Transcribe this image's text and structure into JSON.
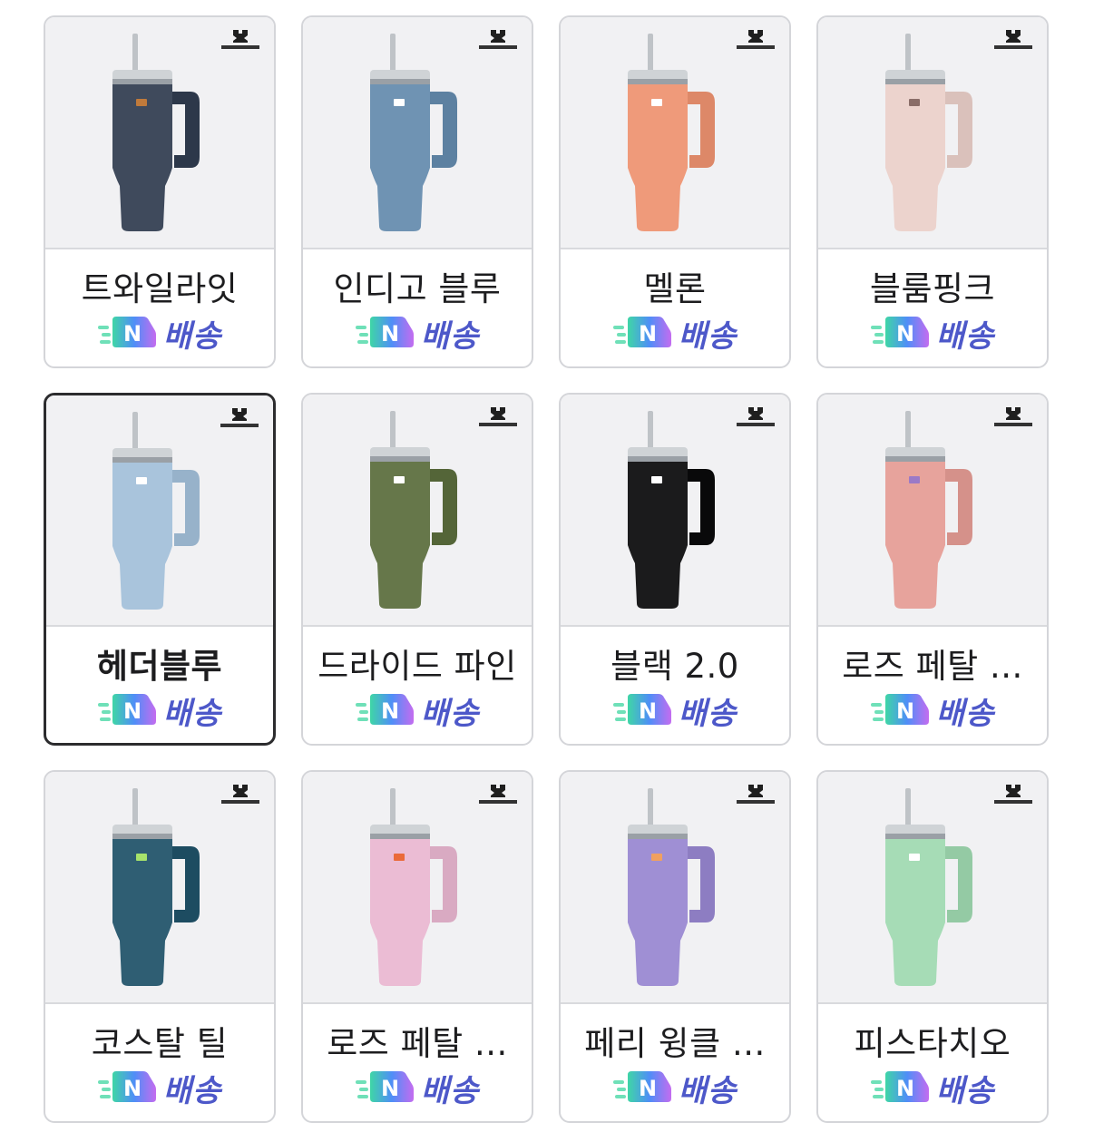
{
  "products": [
    {
      "name": "트와일라잇",
      "color": "#3f4a5c",
      "accent": "#c07a3b",
      "selected": false
    },
    {
      "name": "인디고 블루",
      "color": "#6f93b3",
      "accent": "#ffffff",
      "selected": false
    },
    {
      "name": "멜론",
      "color": "#ef9a7a",
      "accent": "#ffffff",
      "selected": false
    },
    {
      "name": "블룸핑크",
      "color": "#ecd3cd",
      "accent": "#8a6d68",
      "selected": false
    },
    {
      "name": "헤더블루",
      "color": "#a9c4dc",
      "accent": "#ffffff",
      "selected": true
    },
    {
      "name": "드라이드 파인",
      "color": "#66774a",
      "accent": "#ffffff",
      "selected": false
    },
    {
      "name": "블랙 2.0",
      "color": "#1b1b1c",
      "accent": "#ffffff",
      "selected": false
    },
    {
      "name": "로즈 페탈 ...",
      "color": "#e7a39c",
      "accent": "#9b7ac7",
      "selected": false
    },
    {
      "name": "코스탈 틸",
      "color": "#2f5e73",
      "accent": "#a7e36b",
      "selected": false
    },
    {
      "name": "로즈 페탈 ...",
      "color": "#ebbcd4",
      "accent": "#ea6a3a",
      "selected": false
    },
    {
      "name": "페리 윙클 ...",
      "color": "#9f8fd4",
      "accent": "#f0a060",
      "selected": false
    },
    {
      "name": "피스타치오",
      "color": "#a6dcb6",
      "accent": "#ffffff",
      "selected": false
    }
  ],
  "shipping": {
    "badge_letter": "N",
    "label": "배송",
    "label_color": "#4d58c9"
  },
  "brand_icon": "stanley-logo-icon",
  "product_icon": "tumbler-icon"
}
